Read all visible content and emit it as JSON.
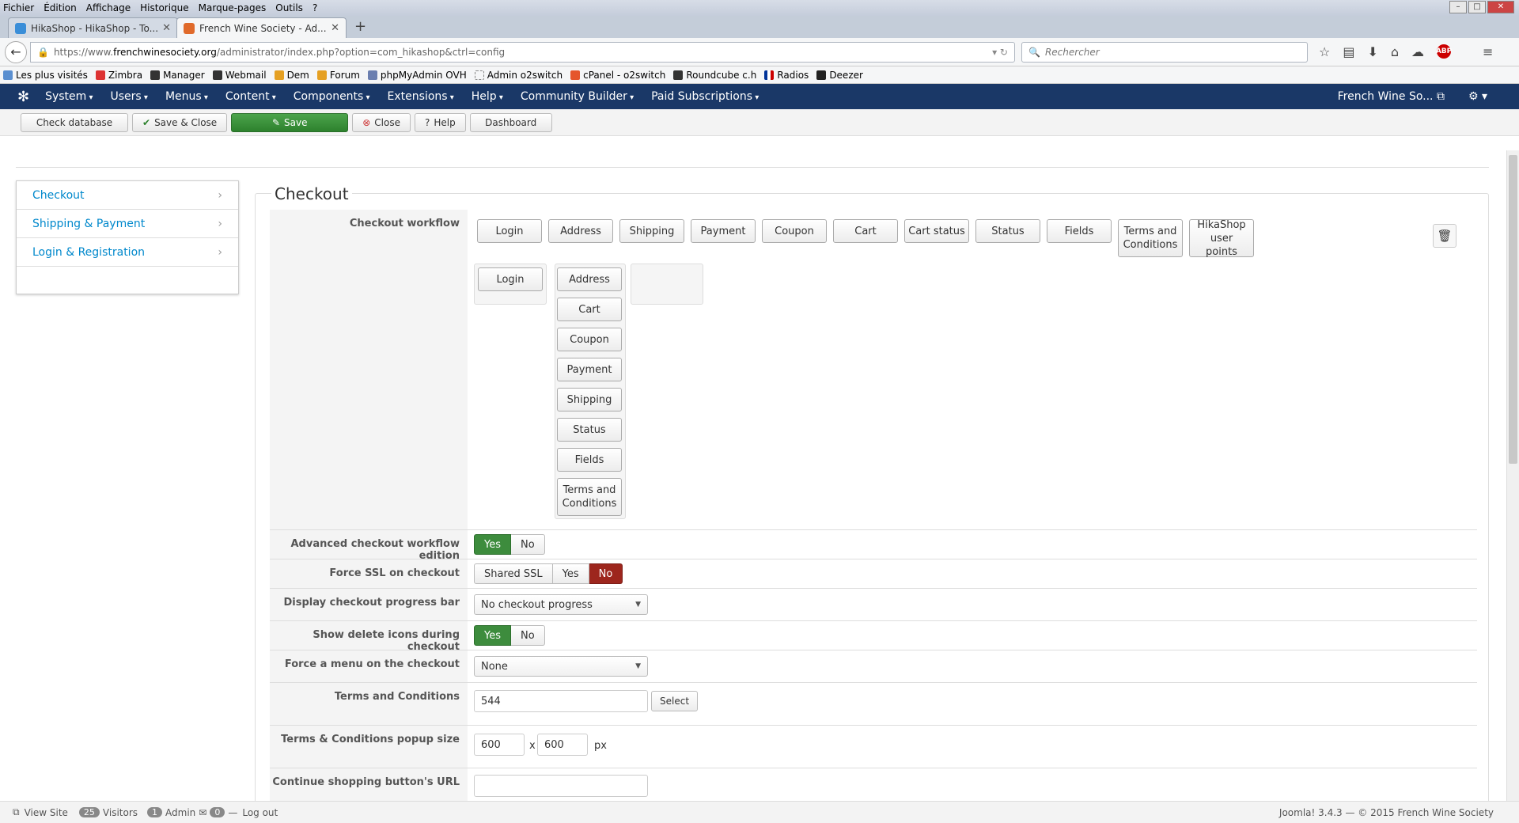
{
  "browser": {
    "menu": [
      "Fichier",
      "Édition",
      "Affichage",
      "Historique",
      "Marque-pages",
      "Outils",
      "?"
    ],
    "tabs": [
      {
        "label": "HikaShop - HikaShop - To...",
        "active": false
      },
      {
        "label": "French Wine Society - Ad...",
        "active": true
      }
    ],
    "url_prefix": "https://www.",
    "url_domain": "frenchwinesociety.org",
    "url_rest": "/administrator/index.php?option=com_hikashop&ctrl=config",
    "search_placeholder": "Rechercher",
    "abp_label": "ABP",
    "bookmarks": [
      "Les plus visités",
      "Zimbra",
      "Manager",
      "Webmail",
      "Dem",
      "Forum",
      "phpMyAdmin OVH",
      "Admin o2switch",
      "cPanel - o2switch",
      "Roundcube c.h",
      "Radios",
      "Deezer"
    ]
  },
  "admin": {
    "menu": [
      "System",
      "Users",
      "Menus",
      "Content",
      "Components",
      "Extensions",
      "Help",
      "Community Builder",
      "Paid Subscriptions"
    ],
    "site_name": "French Wine So...",
    "toolbar": {
      "check_db": "Check database",
      "save_close": "Save & Close",
      "save": "Save",
      "close": "Close",
      "help": "Help",
      "dashboard": "Dashboard"
    }
  },
  "sidebar": [
    "Checkout",
    "Shipping & Payment",
    "Login & Registration"
  ],
  "section_title": "Checkout",
  "workflow": {
    "label": "Checkout workflow",
    "palette": [
      "Login",
      "Address",
      "Shipping",
      "Payment",
      "Coupon",
      "Cart",
      "Cart status",
      "Status",
      "Fields",
      "Terms and Conditions",
      "HikaShop user points"
    ],
    "step1": [
      "Login"
    ],
    "step2": [
      "Address",
      "Cart",
      "Coupon",
      "Payment",
      "Shipping",
      "Status",
      "Fields",
      "Terms and Conditions"
    ]
  },
  "fields": {
    "advanced": {
      "label": "Advanced checkout workflow edition",
      "yes": "Yes",
      "no": "No"
    },
    "ssl": {
      "label": "Force SSL on checkout",
      "shared": "Shared SSL",
      "yes": "Yes",
      "no": "No"
    },
    "progress": {
      "label": "Display checkout progress bar",
      "value": "No checkout progress"
    },
    "delete_icons": {
      "label": "Show delete icons during checkout",
      "yes": "Yes",
      "no": "No"
    },
    "force_menu": {
      "label": "Force a menu on the checkout",
      "value": "None"
    },
    "terms": {
      "label": "Terms and Conditions",
      "value": "544",
      "button": "Select"
    },
    "popup": {
      "label": "Terms & Conditions popup size",
      "w": "600",
      "sep": "x",
      "h": "600",
      "unit": "px"
    },
    "continue_url": {
      "label": "Continue shopping button's URL",
      "value": ""
    }
  },
  "status": {
    "view_site": "View Site",
    "visitors_count": "25",
    "visitors": "Visitors",
    "admin_count": "1",
    "admin": "Admin",
    "msg_count": "0",
    "logout": "Log out",
    "copyright": "Joomla! 3.4.3  — © 2015 French Wine Society"
  }
}
